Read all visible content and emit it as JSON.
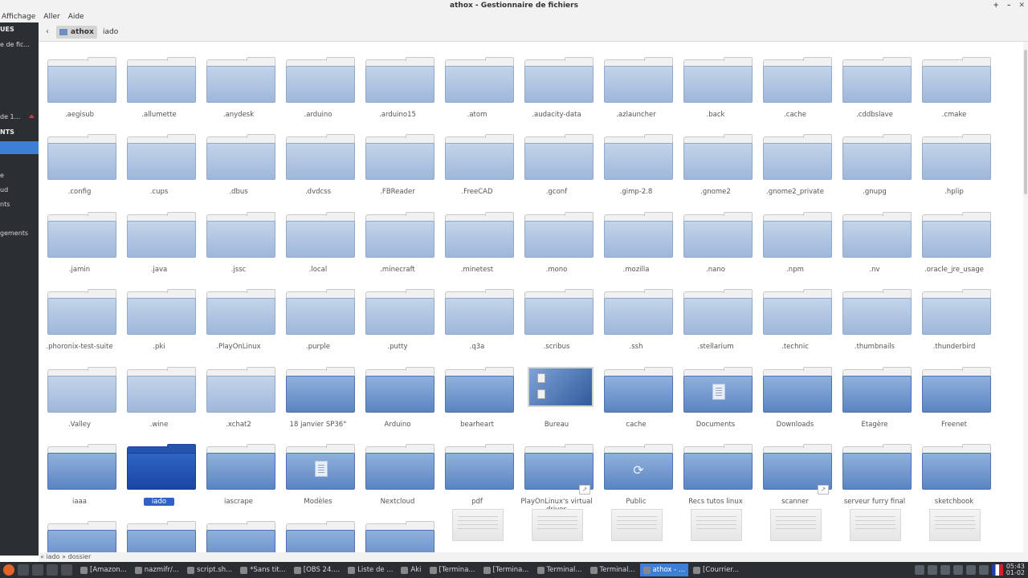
{
  "window": {
    "title": "athox - Gestionnaire de fichiers",
    "controls": [
      "+",
      "–",
      "✕"
    ]
  },
  "menu": [
    "Affichage",
    "Aller",
    "Aide"
  ],
  "sidebar": {
    "items": [
      "UES",
      "e de fic...",
      "de 1...",
      "NTS",
      "e",
      "ud",
      "nts",
      "gements"
    ]
  },
  "pathbar": {
    "home_label": "athox",
    "current_label": "iado"
  },
  "grid": {
    "rows": [
      [
        ".aegisub",
        ".allumette",
        ".anydesk",
        ".arduino",
        ".arduino15",
        ".atom",
        ".audacity-data",
        ".azlauncher",
        ".back",
        ".cache",
        ".cddbslave",
        ".cmake"
      ],
      [
        ".config",
        ".cups",
        ".dbus",
        ".dvdcss",
        ".FBReader",
        ".FreeCAD",
        ".gconf",
        ".gimp-2.8",
        ".gnome2",
        ".gnome2_private",
        ".gnupg",
        ".hplip"
      ],
      [
        ".jamin",
        ".java",
        ".jssc",
        ".local",
        ".minecraft",
        ".minetest",
        ".mono",
        ".mozilla",
        ".nano",
        ".npm",
        ".nv",
        ".oracle_jre_usage"
      ],
      [
        ".phoronix-test-suite",
        ".pki",
        ".PlayOnLinux",
        ".purple",
        ".putty",
        ".q3a",
        ".scribus",
        ".ssh",
        ".stellarium",
        ".technic",
        ".thumbnails",
        ".thunderbird"
      ],
      [
        ".Valley",
        ".wine",
        ".xchat2",
        "18 janvier SP36°",
        "Arduino",
        "bearheart",
        "Bureau",
        "cache",
        "Documents",
        "Downloads",
        "Etagère",
        "Freenet"
      ],
      [
        "iaaa",
        "iado",
        "iascrape",
        "Modèles",
        "Nextcloud",
        "pdf",
        "PlayOnLinux's virtual drives",
        "Public",
        "Recs tutos linux",
        "scanner",
        "serveur furry final",
        "sketchbook"
      ]
    ]
  },
  "statusbar": {
    "text": "« iado » dossier"
  },
  "taskbar": {
    "tasks": [
      "[Amazon...",
      "nazmifr/...",
      "script.sh...",
      "*Sans tit...",
      "[OBS 24....",
      "Liste de ...",
      "Aki",
      "[Termina...",
      "[Termina...",
      "Terminal...",
      "Terminal...",
      "athox - ...",
      "[Courrier..."
    ],
    "active_task": 11,
    "clock_time": "05:43",
    "clock_date": "01-02"
  }
}
